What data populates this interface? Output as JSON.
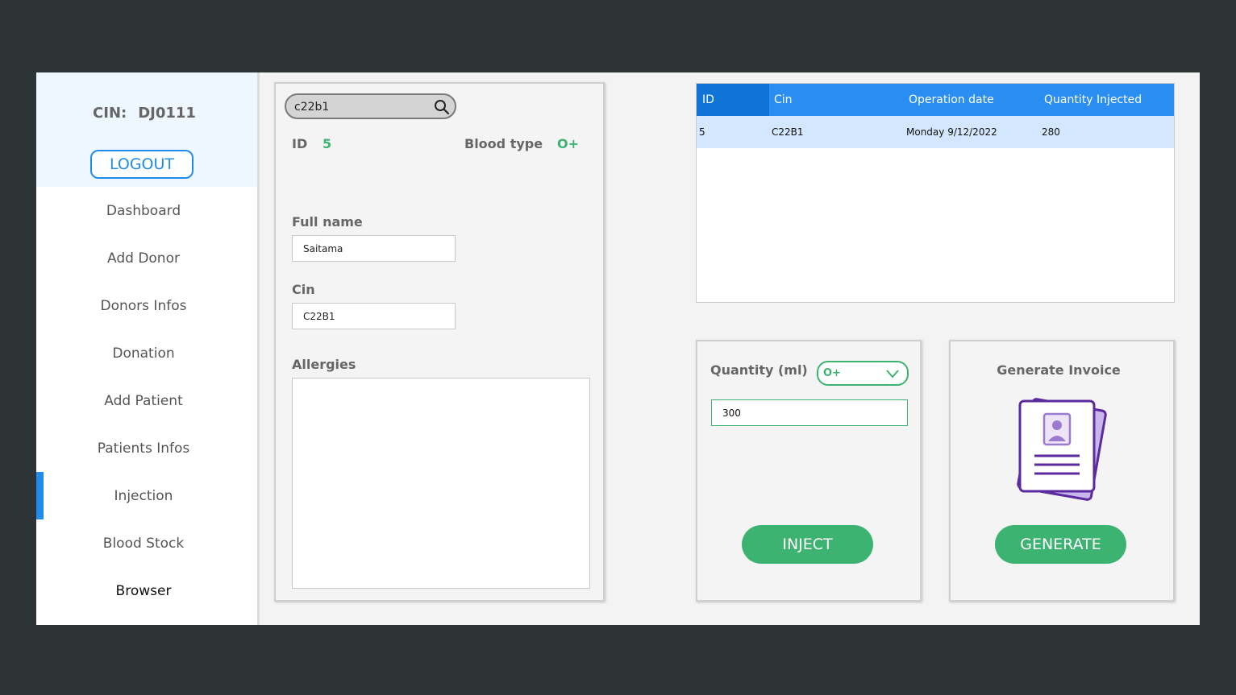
{
  "sidebar": {
    "cin_label": "CIN:",
    "cin_value": "DJ0111",
    "logout_label": "LOGOUT",
    "items": [
      {
        "label": "Dashboard"
      },
      {
        "label": "Add Donor"
      },
      {
        "label": "Donors Infos"
      },
      {
        "label": "Donation"
      },
      {
        "label": "Add Patient"
      },
      {
        "label": "Patients Infos"
      },
      {
        "label": "Injection"
      },
      {
        "label": "Blood Stock"
      },
      {
        "label": "Browser"
      }
    ],
    "active_item": "Injection"
  },
  "patient": {
    "search_value": "c22b1",
    "id_label": "ID",
    "id_value": "5",
    "blood_type_label": "Blood type",
    "blood_type_value": "O+",
    "full_name_label": "Full name",
    "full_name_value": "Saitama",
    "cin_label": "Cin",
    "cin_value": "C22B1",
    "allergies_label": "Allergies",
    "allergies_value": ""
  },
  "table": {
    "columns": [
      "ID",
      "Cin",
      "Operation date",
      "Quantity Injected"
    ],
    "rows": [
      [
        "5",
        "C22B1",
        "Monday 9/12/2022",
        "280"
      ]
    ]
  },
  "injection": {
    "quantity_label": "Quantity (ml)",
    "blood_type_selected": "O+",
    "quantity_value": "300",
    "inject_label": "INJECT"
  },
  "invoice": {
    "title": "Generate Invoice",
    "generate_label": "GENERATE"
  },
  "colors": {
    "accent_blue": "#1f8ceb",
    "accent_green": "#3cb371",
    "icon_purple": "#5b2a9e"
  }
}
